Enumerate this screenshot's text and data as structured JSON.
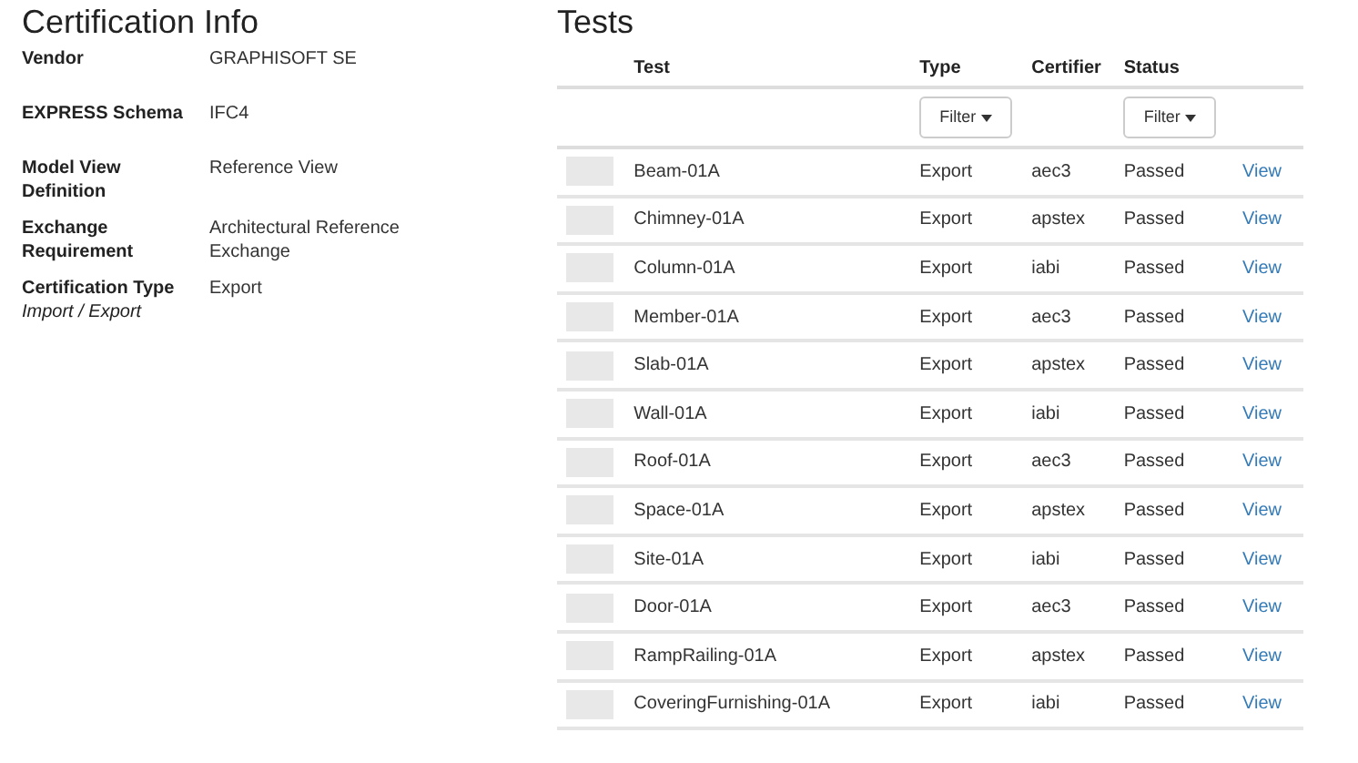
{
  "certification_info": {
    "title": "Certification Info",
    "fields": [
      {
        "label": "Vendor",
        "value": "GRAPHISOFT SE"
      },
      {
        "label": "EXPRESS Schema",
        "value": "IFC4"
      },
      {
        "label": "Model View Definition",
        "value": "Reference View"
      },
      {
        "label": "Exchange Requirement",
        "value": "Architectural Reference Exchange"
      },
      {
        "label": "Certification Type",
        "sublabel": "Import / Export",
        "value": "Export"
      }
    ]
  },
  "tests": {
    "title": "Tests",
    "columns": [
      {
        "label": "Test"
      },
      {
        "label": "Type",
        "filter": "Filter"
      },
      {
        "label": "Certifier"
      },
      {
        "label": "Status",
        "filter": "Filter"
      }
    ],
    "rows": [
      {
        "test": "Beam-01A",
        "type": "Export",
        "certifier": "aec3",
        "status": "Passed",
        "action": "View"
      },
      {
        "test": "Chimney-01A",
        "type": "Export",
        "certifier": "apstex",
        "status": "Passed",
        "action": "View"
      },
      {
        "test": "Column-01A",
        "type": "Export",
        "certifier": "iabi",
        "status": "Passed",
        "action": "View"
      },
      {
        "test": "Member-01A",
        "type": "Export",
        "certifier": "aec3",
        "status": "Passed",
        "action": "View"
      },
      {
        "test": "Slab-01A",
        "type": "Export",
        "certifier": "apstex",
        "status": "Passed",
        "action": "View"
      },
      {
        "test": "Wall-01A",
        "type": "Export",
        "certifier": "iabi",
        "status": "Passed",
        "action": "View"
      },
      {
        "test": "Roof-01A",
        "type": "Export",
        "certifier": "aec3",
        "status": "Passed",
        "action": "View"
      },
      {
        "test": "Space-01A",
        "type": "Export",
        "certifier": "apstex",
        "status": "Passed",
        "action": "View"
      },
      {
        "test": "Site-01A",
        "type": "Export",
        "certifier": "iabi",
        "status": "Passed",
        "action": "View"
      },
      {
        "test": "Door-01A",
        "type": "Export",
        "certifier": "aec3",
        "status": "Passed",
        "action": "View"
      },
      {
        "test": "RampRailing-01A",
        "type": "Export",
        "certifier": "apstex",
        "status": "Passed",
        "action": "View"
      },
      {
        "test": "CoveringFurnishing-01A",
        "type": "Export",
        "certifier": "iabi",
        "status": "Passed",
        "action": "View"
      }
    ]
  }
}
